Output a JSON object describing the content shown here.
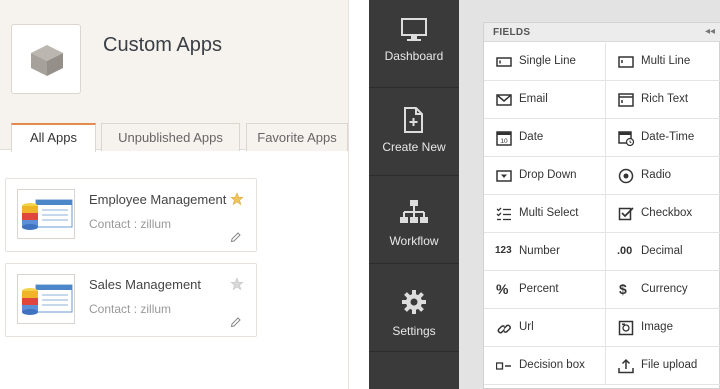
{
  "header": {
    "title": "Custom Apps"
  },
  "tabs": [
    {
      "label": "All Apps"
    },
    {
      "label": "Unpublished Apps"
    },
    {
      "label": "Favorite Apps"
    }
  ],
  "apps": [
    {
      "name": "Employee Management",
      "contact": "Contact : zillum",
      "favorite": true
    },
    {
      "name": "Sales Management",
      "contact": "Contact : zillum",
      "favorite": false
    }
  ],
  "sidebar": {
    "items": [
      {
        "label": "Dashboard",
        "icon": "monitor-icon"
      },
      {
        "label": "Create New",
        "icon": "new-file-icon"
      },
      {
        "label": "Workflow",
        "icon": "workflow-icon"
      },
      {
        "label": "Settings",
        "icon": "gear-icon"
      }
    ]
  },
  "fields_panel": {
    "title": "FIELDS",
    "collapse_label": "◂◂",
    "items": [
      {
        "label": "Single Line",
        "icon": "single-line-icon"
      },
      {
        "label": "Multi Line",
        "icon": "multi-line-icon"
      },
      {
        "label": "Email",
        "icon": "email-icon"
      },
      {
        "label": "Rich Text",
        "icon": "rich-text-icon"
      },
      {
        "label": "Date",
        "icon": "date-icon",
        "icon_text": "10"
      },
      {
        "label": "Date-Time",
        "icon": "date-time-icon"
      },
      {
        "label": "Drop Down",
        "icon": "dropdown-icon"
      },
      {
        "label": "Radio",
        "icon": "radio-icon"
      },
      {
        "label": "Multi Select",
        "icon": "multi-select-icon"
      },
      {
        "label": "Checkbox",
        "icon": "checkbox-icon"
      },
      {
        "label": "Number",
        "icon": "number-icon",
        "icon_text": "123"
      },
      {
        "label": "Decimal",
        "icon": "decimal-icon",
        "icon_text": ".00"
      },
      {
        "label": "Percent",
        "icon": "percent-icon",
        "icon_text": "%"
      },
      {
        "label": "Currency",
        "icon": "currency-icon",
        "icon_text": "$"
      },
      {
        "label": "Url",
        "icon": "link-icon"
      },
      {
        "label": "Image",
        "icon": "image-icon"
      },
      {
        "label": "Decision box",
        "icon": "decision-box-icon"
      },
      {
        "label": "File upload",
        "icon": "upload-icon"
      }
    ]
  },
  "colors": {
    "accent": "#e38b4f",
    "sidebar": "#3a3a3a",
    "star_active": "#f2c55c"
  }
}
